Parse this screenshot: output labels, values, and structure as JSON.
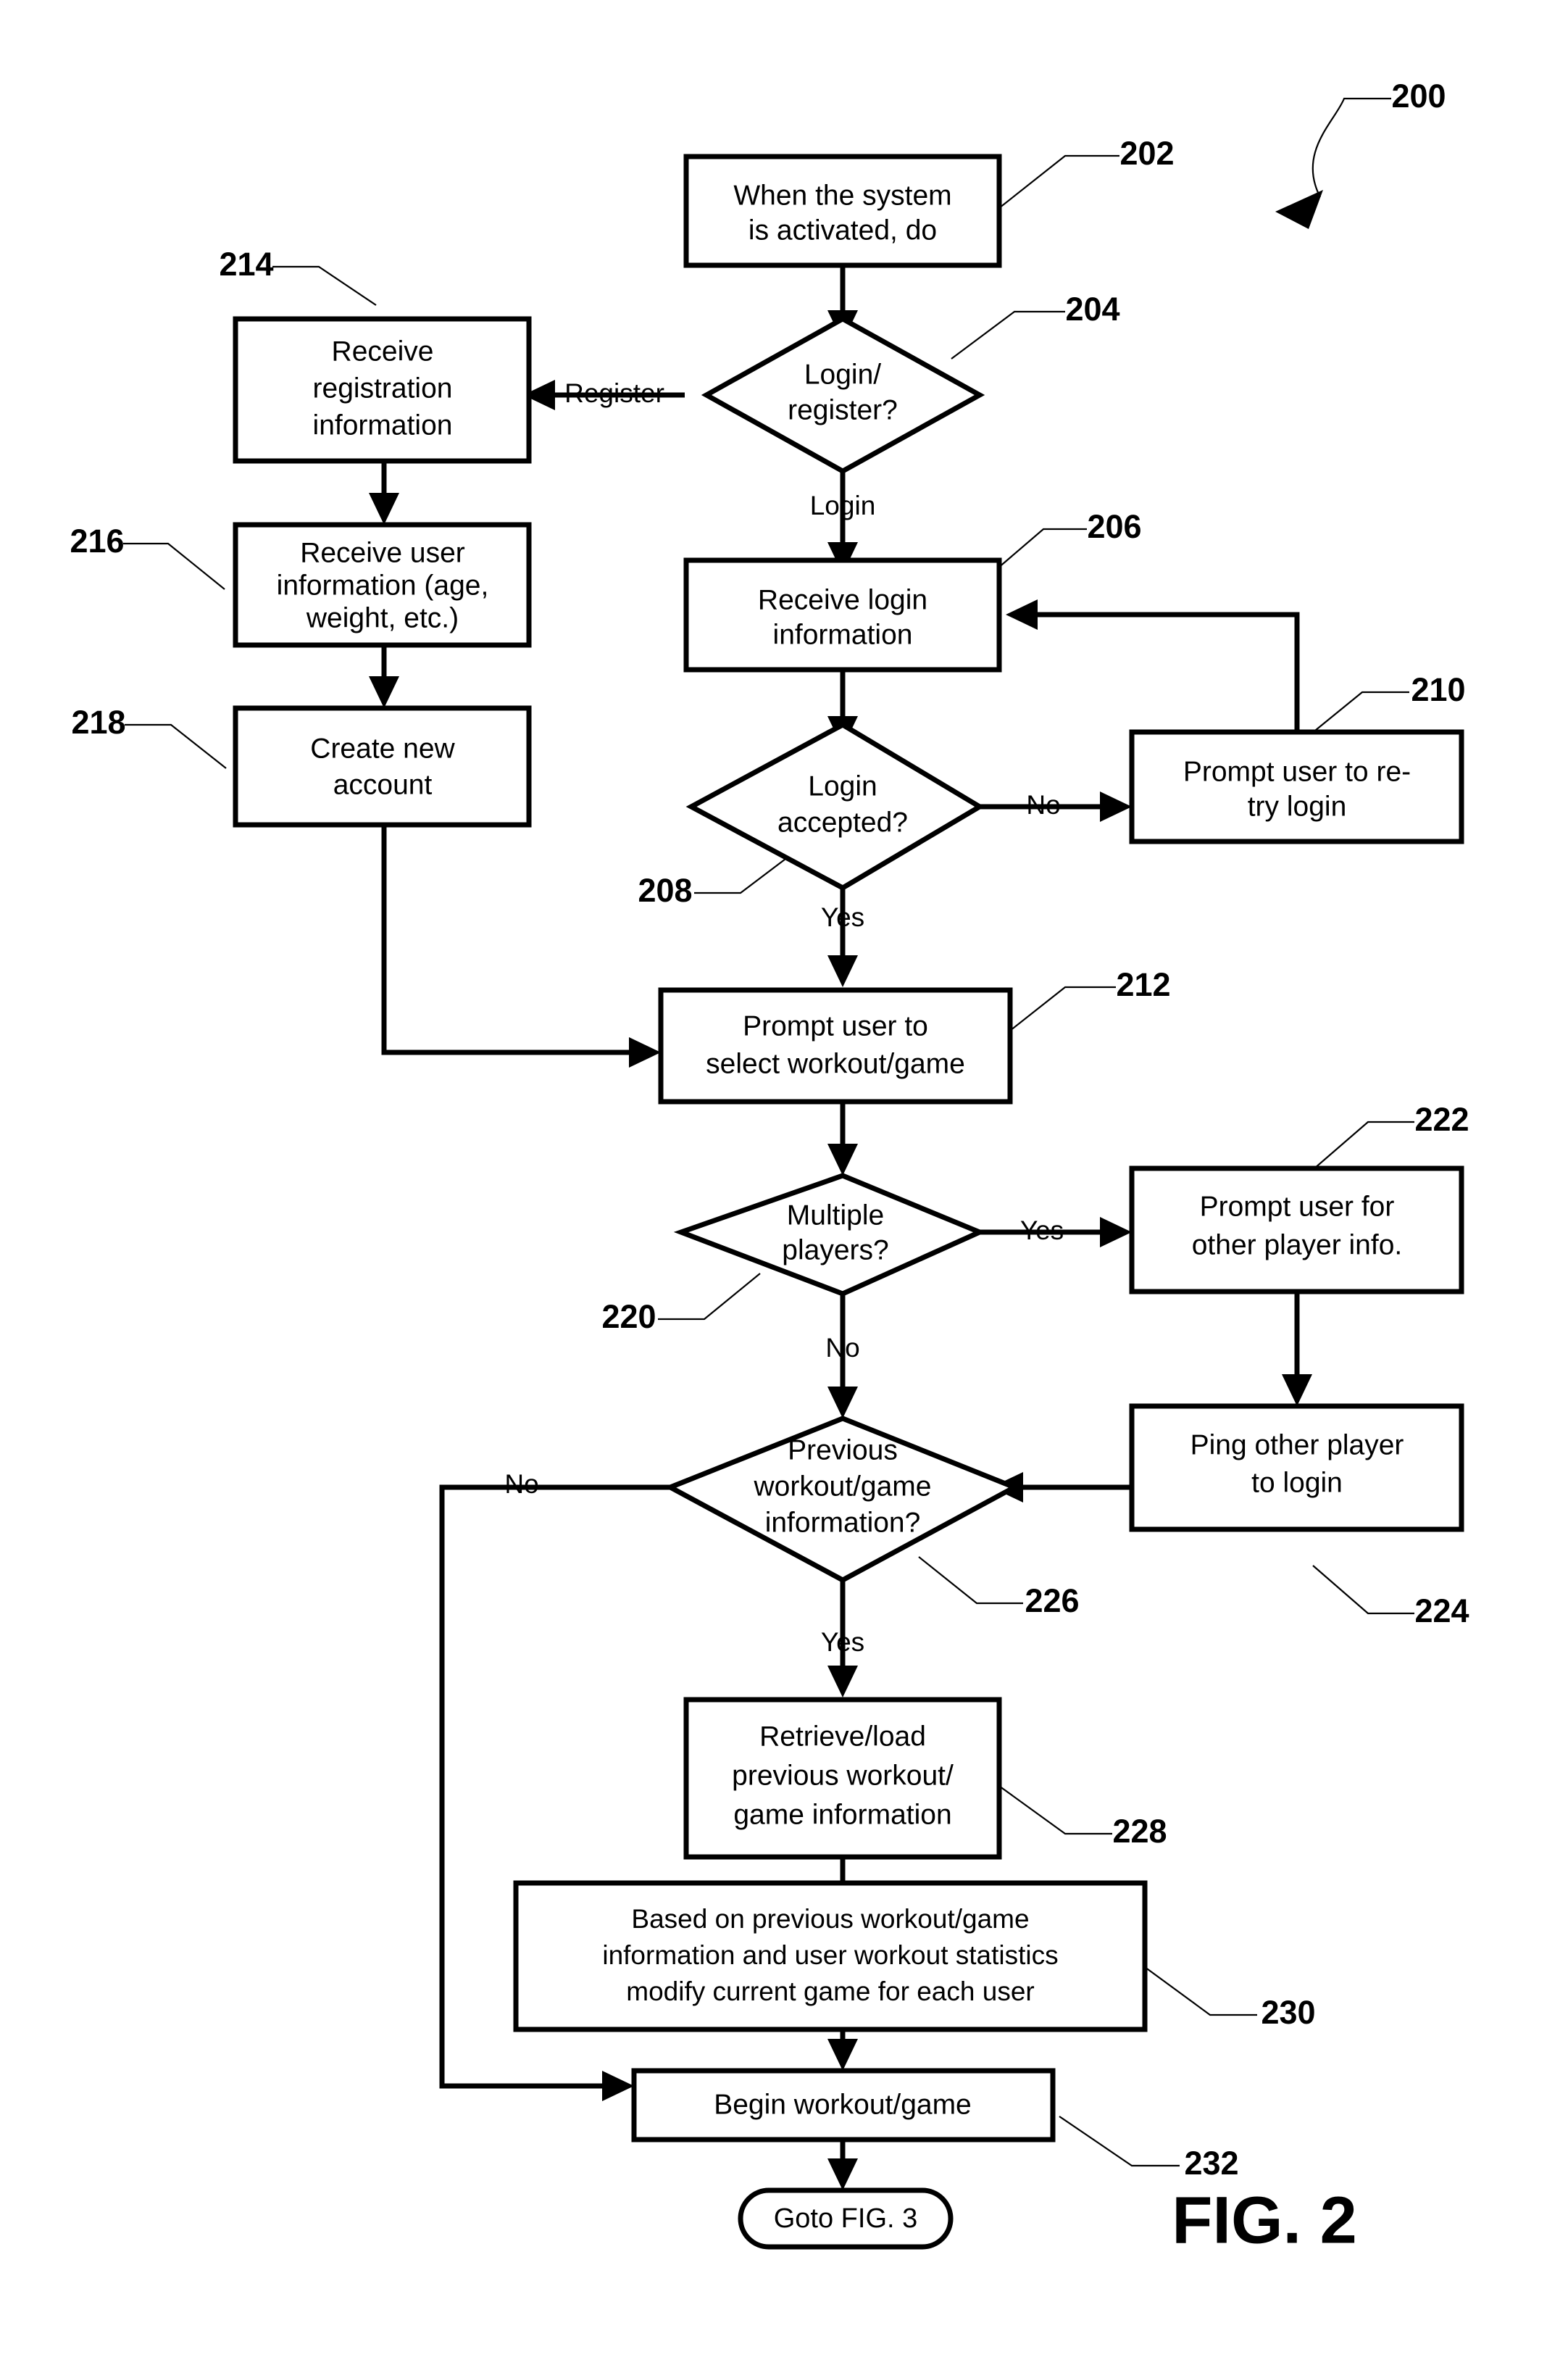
{
  "figure": {
    "label": "FIG. 2",
    "overall_ref": "200"
  },
  "nodes": {
    "n202": {
      "ref": "202",
      "type": "process",
      "lines": [
        "When the system",
        "is activated, do"
      ]
    },
    "n204": {
      "ref": "204",
      "type": "decision",
      "lines": [
        "Login/",
        "register?"
      ]
    },
    "n206": {
      "ref": "206",
      "type": "process",
      "lines": [
        "Receive login",
        "information"
      ]
    },
    "n208": {
      "ref": "208",
      "type": "decision",
      "lines": [
        "Login",
        "accepted?"
      ]
    },
    "n210": {
      "ref": "210",
      "type": "process",
      "lines": [
        "Prompt user to re-",
        "try login"
      ]
    },
    "n212": {
      "ref": "212",
      "type": "process",
      "lines": [
        "Prompt user to",
        "select workout/game"
      ]
    },
    "n214": {
      "ref": "214",
      "type": "process",
      "lines": [
        "Receive",
        "registration",
        "information"
      ]
    },
    "n216": {
      "ref": "216",
      "type": "process",
      "lines": [
        "Receive user",
        "information (age,",
        "weight, etc.)"
      ]
    },
    "n218": {
      "ref": "218",
      "type": "process",
      "lines": [
        "Create new",
        "account"
      ]
    },
    "n220": {
      "ref": "220",
      "type": "decision",
      "lines": [
        "Multiple",
        "players?"
      ]
    },
    "n222": {
      "ref": "222",
      "type": "process",
      "lines": [
        "Prompt user for",
        "other player info."
      ]
    },
    "n224": {
      "ref": "224",
      "type": "process",
      "lines": [
        "Ping other player",
        "to login"
      ]
    },
    "n226": {
      "ref": "226",
      "type": "decision",
      "lines": [
        "Previous",
        "workout/game",
        "information?"
      ]
    },
    "n228": {
      "ref": "228",
      "type": "process",
      "lines": [
        "Retrieve/load",
        "previous workout/",
        "game information"
      ]
    },
    "n230": {
      "ref": "230",
      "type": "process",
      "lines": [
        "Based on previous workout/game",
        "information and user workout statistics",
        "modify current game for each user"
      ]
    },
    "n232": {
      "ref": "232",
      "type": "process",
      "lines": [
        "Begin workout/game"
      ]
    },
    "n234": {
      "ref": "",
      "type": "terminal",
      "lines": [
        "Goto FIG. 3"
      ]
    }
  },
  "edge_labels": {
    "register": "Register",
    "login": "Login",
    "login_no": "No",
    "login_yes": "Yes",
    "players_yes": "Yes",
    "players_no": "No",
    "prev_no": "No",
    "prev_yes": "Yes"
  },
  "colors": {
    "stroke": "#000000",
    "fill": "#ffffff"
  }
}
